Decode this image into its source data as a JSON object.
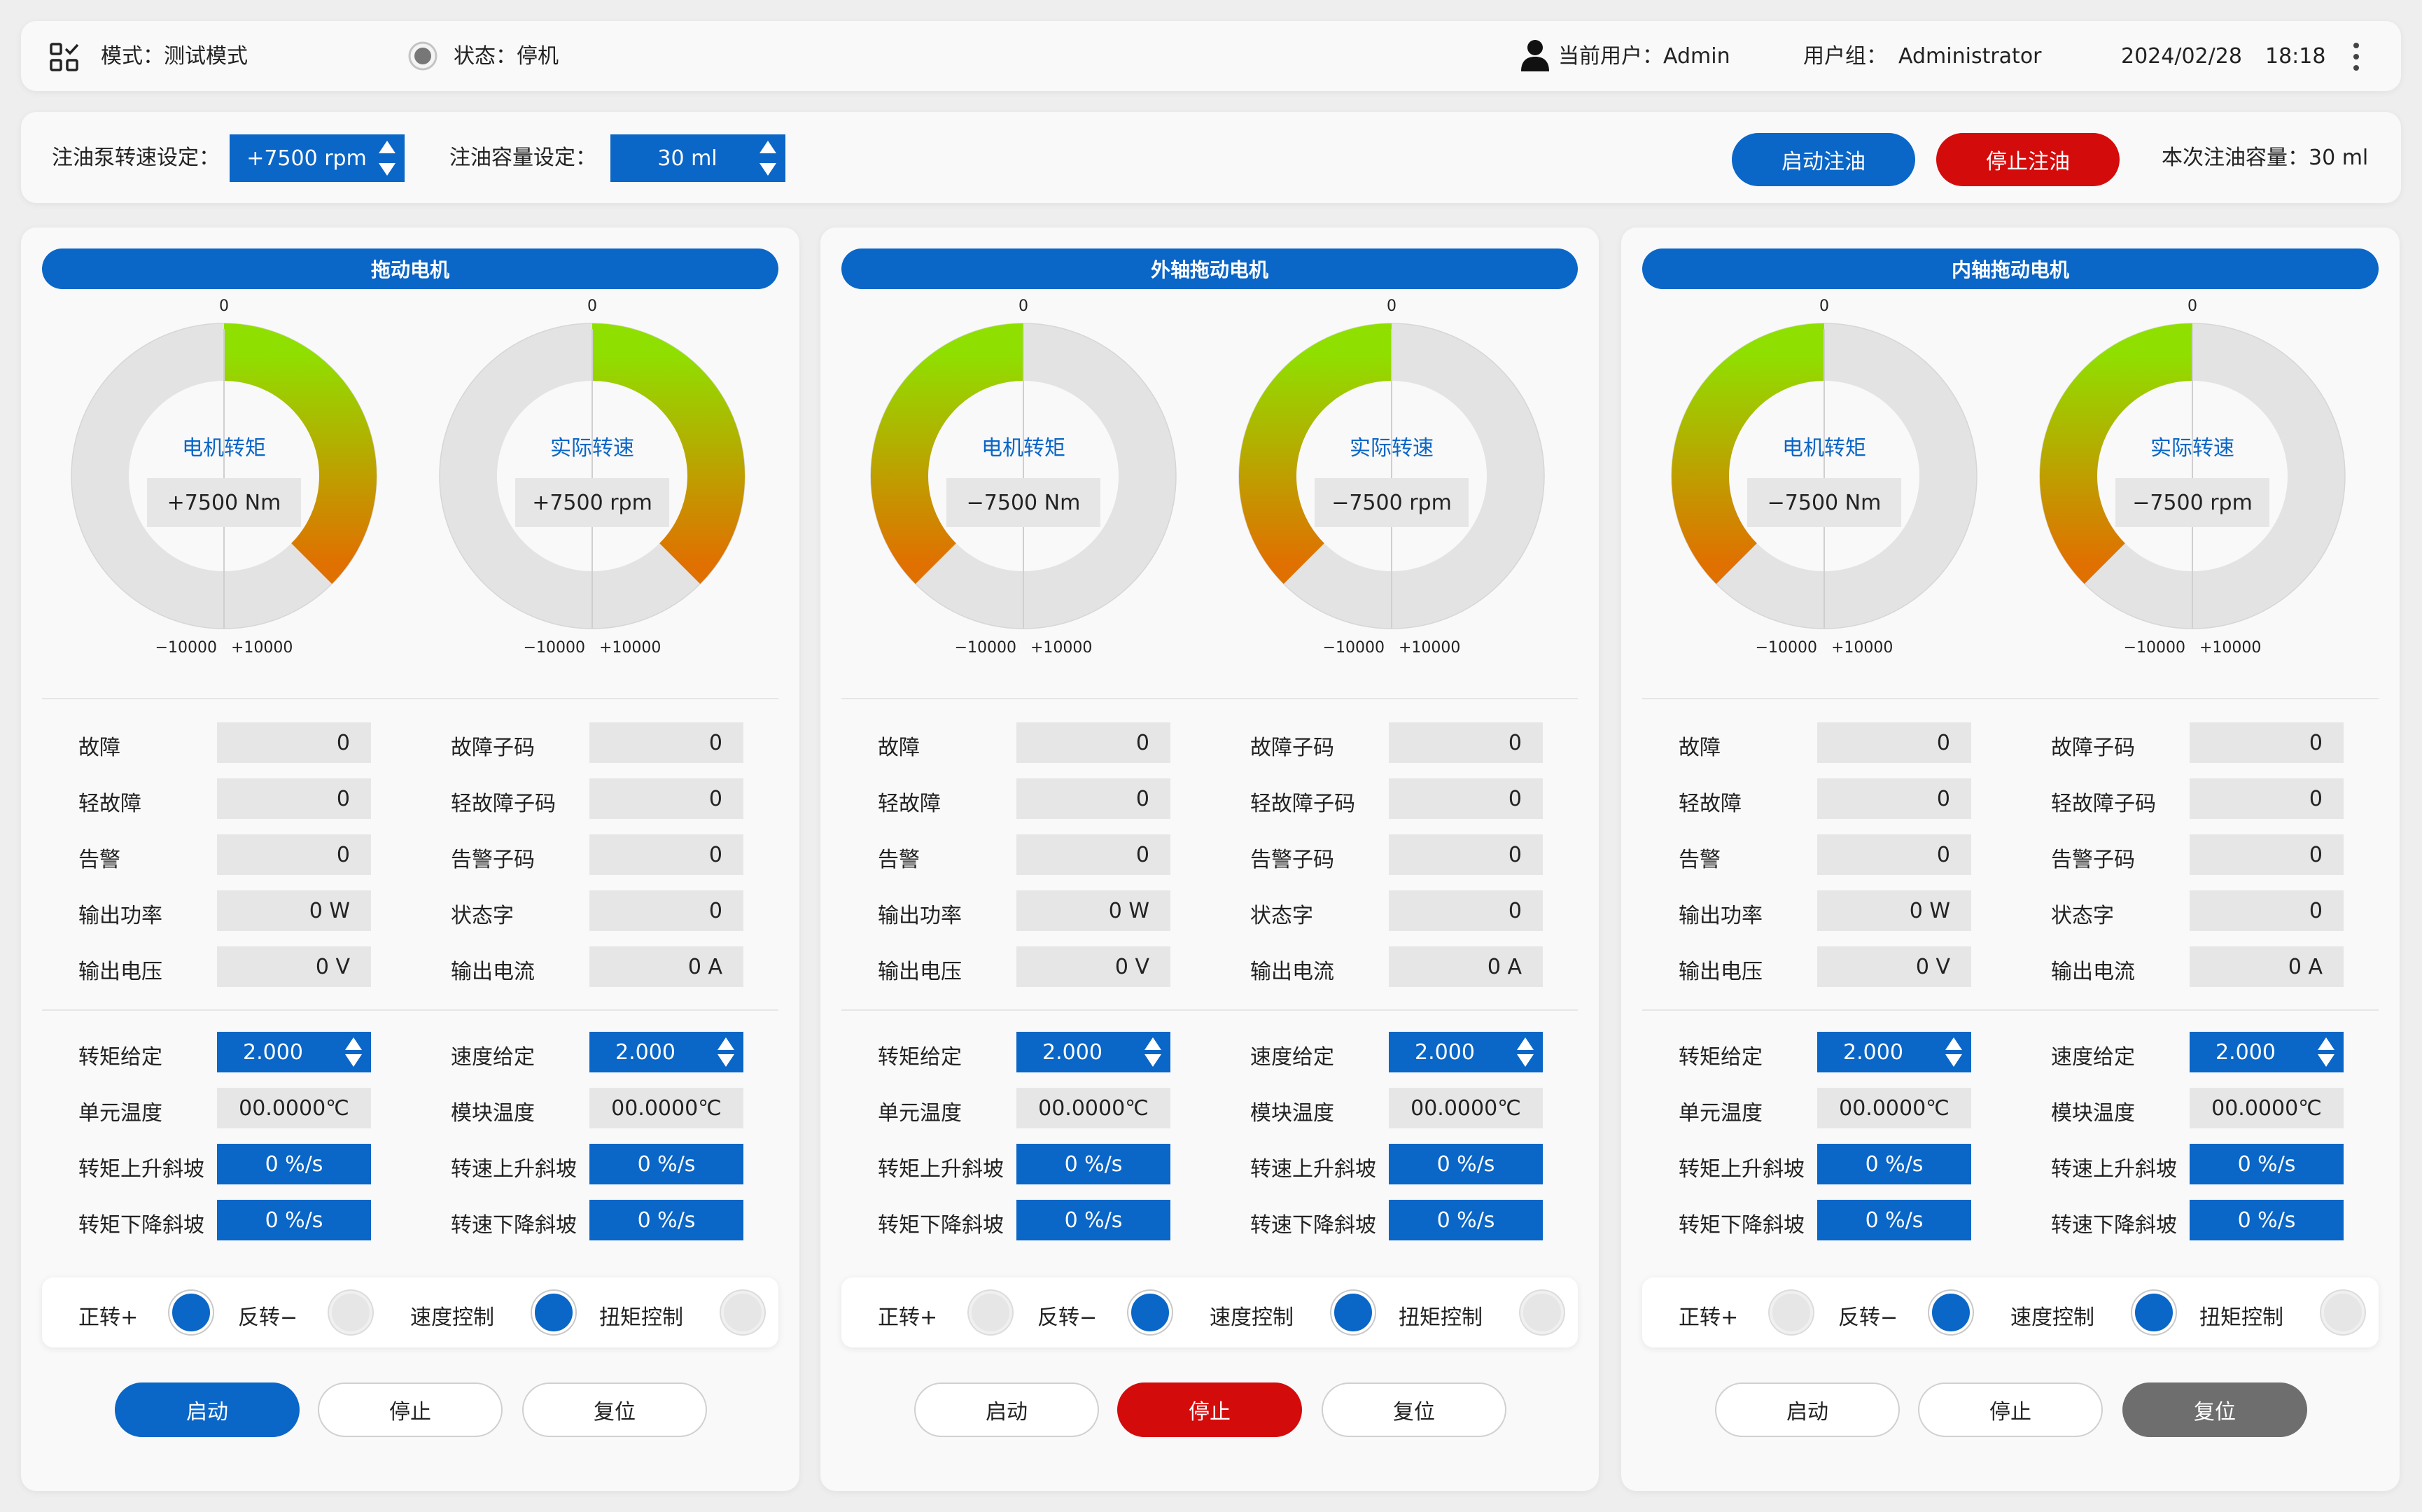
{
  "header": {
    "mode_label": "模式：测试模式",
    "status_label": "状态：停机",
    "user_label": "当前用户：Admin",
    "group_label": "用户组：",
    "group_value": "Administrator",
    "date": "2024/02/28",
    "time": "18:18",
    "icons": {
      "menu": "grid-check-icon",
      "status": "radio-status-icon",
      "user": "user-icon",
      "more": "kebab-menu-icon"
    }
  },
  "oil": {
    "pump_speed_label": "注油泵转速设定：",
    "pump_speed_value": "+7500 rpm",
    "volume_label": "注油容量设定：",
    "volume_value": "30 ml",
    "start_label": "启动注油",
    "stop_label": "停止注油",
    "current_volume_label": "本次注油容量：30 ml"
  },
  "colors": {
    "accent": "#0a66c7",
    "danger": "#d40b0b",
    "neutral": "#6e6e6e",
    "gauge_start": "#8fe000",
    "gauge_end": "#e07000"
  },
  "panels": [
    {
      "title": "拖动电机",
      "gauges": [
        {
          "title": "电机转矩",
          "value": "+7500 Nm",
          "reading": 7500,
          "top": "0",
          "left": "−10000",
          "right": "+10000"
        },
        {
          "title": "实际转速",
          "value": "+7500 rpm",
          "reading": 7500,
          "top": "0",
          "left": "−10000",
          "right": "+10000"
        }
      ],
      "status": {
        "fault": {
          "label": "故障",
          "value": "0"
        },
        "fault_code": {
          "label": "故障子码",
          "value": "0"
        },
        "minor": {
          "label": "轻故障",
          "value": "0"
        },
        "minor_code": {
          "label": "轻故障子码",
          "value": "0"
        },
        "alarm": {
          "label": "告警",
          "value": "0"
        },
        "alarm_code": {
          "label": "告警子码",
          "value": "0"
        },
        "power": {
          "label": "输出功率",
          "value": "0 W"
        },
        "word": {
          "label": "状态字",
          "value": "0"
        },
        "voltage": {
          "label": "输出电压",
          "value": "0 V"
        },
        "current": {
          "label": "输出电流",
          "value": "0 A"
        }
      },
      "settings": {
        "torque_set": {
          "label": "转矩给定",
          "value": "2.000"
        },
        "speed_set": {
          "label": "速度给定",
          "value": "2.000"
        },
        "unit_temp": {
          "label": "单元温度",
          "value": "00.0000℃"
        },
        "module_temp": {
          "label": "模块温度",
          "value": "00.0000℃"
        },
        "torque_up": {
          "label": "转矩上升斜坡",
          "value": "0 %/s"
        },
        "speed_up": {
          "label": "转速上升斜坡",
          "value": "0 %/s"
        },
        "torque_down": {
          "label": "转矩下降斜坡",
          "value": "0 %/s"
        },
        "speed_down": {
          "label": "转速下降斜坡",
          "value": "0 %/s"
        }
      },
      "toggles": {
        "forward": "正转+",
        "reverse": "反转−",
        "speed_ctrl": "速度控制",
        "torque_ctrl": "扭矩控制"
      },
      "buttons": {
        "start": "启动",
        "stop": "停止",
        "reset": "复位"
      }
    },
    {
      "title": "外轴拖动电机",
      "gauges": [
        {
          "title": "电机转矩",
          "value": "−7500 Nm",
          "reading": -7500,
          "top": "0",
          "left": "−10000",
          "right": "+10000"
        },
        {
          "title": "实际转速",
          "value": "−7500 rpm",
          "reading": -7500,
          "top": "0",
          "left": "−10000",
          "right": "+10000"
        }
      ],
      "status": {
        "fault": {
          "label": "故障",
          "value": "0"
        },
        "fault_code": {
          "label": "故障子码",
          "value": "0"
        },
        "minor": {
          "label": "轻故障",
          "value": "0"
        },
        "minor_code": {
          "label": "轻故障子码",
          "value": "0"
        },
        "alarm": {
          "label": "告警",
          "value": "0"
        },
        "alarm_code": {
          "label": "告警子码",
          "value": "0"
        },
        "power": {
          "label": "输出功率",
          "value": "0 W"
        },
        "word": {
          "label": "状态字",
          "value": "0"
        },
        "voltage": {
          "label": "输出电压",
          "value": "0 V"
        },
        "current": {
          "label": "输出电流",
          "value": "0 A"
        }
      },
      "settings": {
        "torque_set": {
          "label": "转矩给定",
          "value": "2.000"
        },
        "speed_set": {
          "label": "速度给定",
          "value": "2.000"
        },
        "unit_temp": {
          "label": "单元温度",
          "value": "00.0000℃"
        },
        "module_temp": {
          "label": "模块温度",
          "value": "00.0000℃"
        },
        "torque_up": {
          "label": "转矩上升斜坡",
          "value": "0 %/s"
        },
        "speed_up": {
          "label": "转速上升斜坡",
          "value": "0 %/s"
        },
        "torque_down": {
          "label": "转矩下降斜坡",
          "value": "0 %/s"
        },
        "speed_down": {
          "label": "转速下降斜坡",
          "value": "0 %/s"
        }
      },
      "toggles": {
        "forward": "正转+",
        "reverse": "反转−",
        "speed_ctrl": "速度控制",
        "torque_ctrl": "扭矩控制"
      },
      "buttons": {
        "start": "启动",
        "stop": "停止",
        "reset": "复位"
      }
    },
    {
      "title": "内轴拖动电机",
      "gauges": [
        {
          "title": "电机转矩",
          "value": "−7500 Nm",
          "reading": -7500,
          "top": "0",
          "left": "−10000",
          "right": "+10000"
        },
        {
          "title": "实际转速",
          "value": "−7500 rpm",
          "reading": -7500,
          "top": "0",
          "left": "−10000",
          "right": "+10000"
        }
      ],
      "status": {
        "fault": {
          "label": "故障",
          "value": "0"
        },
        "fault_code": {
          "label": "故障子码",
          "value": "0"
        },
        "minor": {
          "label": "轻故障",
          "value": "0"
        },
        "minor_code": {
          "label": "轻故障子码",
          "value": "0"
        },
        "alarm": {
          "label": "告警",
          "value": "0"
        },
        "alarm_code": {
          "label": "告警子码",
          "value": "0"
        },
        "power": {
          "label": "输出功率",
          "value": "0 W"
        },
        "word": {
          "label": "状态字",
          "value": "0"
        },
        "voltage": {
          "label": "输出电压",
          "value": "0 V"
        },
        "current": {
          "label": "输出电流",
          "value": "0 A"
        }
      },
      "settings": {
        "torque_set": {
          "label": "转矩给定",
          "value": "2.000"
        },
        "speed_set": {
          "label": "速度给定",
          "value": "2.000"
        },
        "unit_temp": {
          "label": "单元温度",
          "value": "00.0000℃"
        },
        "module_temp": {
          "label": "模块温度",
          "value": "00.0000℃"
        },
        "torque_up": {
          "label": "转矩上升斜坡",
          "value": "0 %/s"
        },
        "speed_up": {
          "label": "转速上升斜坡",
          "value": "0 %/s"
        },
        "torque_down": {
          "label": "转矩下降斜坡",
          "value": "0 %/s"
        },
        "speed_down": {
          "label": "转速下降斜坡",
          "value": "0 %/s"
        }
      },
      "toggles": {
        "forward": "正转+",
        "reverse": "反转−",
        "speed_ctrl": "速度控制",
        "torque_ctrl": "扭矩控制"
      },
      "buttons": {
        "start": "启动",
        "stop": "停止",
        "reset": "复位"
      }
    }
  ],
  "states": {
    "toggles": [
      {
        "forward": true,
        "reverse": false,
        "speed_ctrl": true,
        "torque_ctrl": false
      },
      {
        "forward": false,
        "reverse": true,
        "speed_ctrl": true,
        "torque_ctrl": false
      },
      {
        "forward": false,
        "reverse": true,
        "speed_ctrl": true,
        "torque_ctrl": false
      }
    ],
    "active_button": [
      "start",
      "stop",
      "reset"
    ]
  }
}
